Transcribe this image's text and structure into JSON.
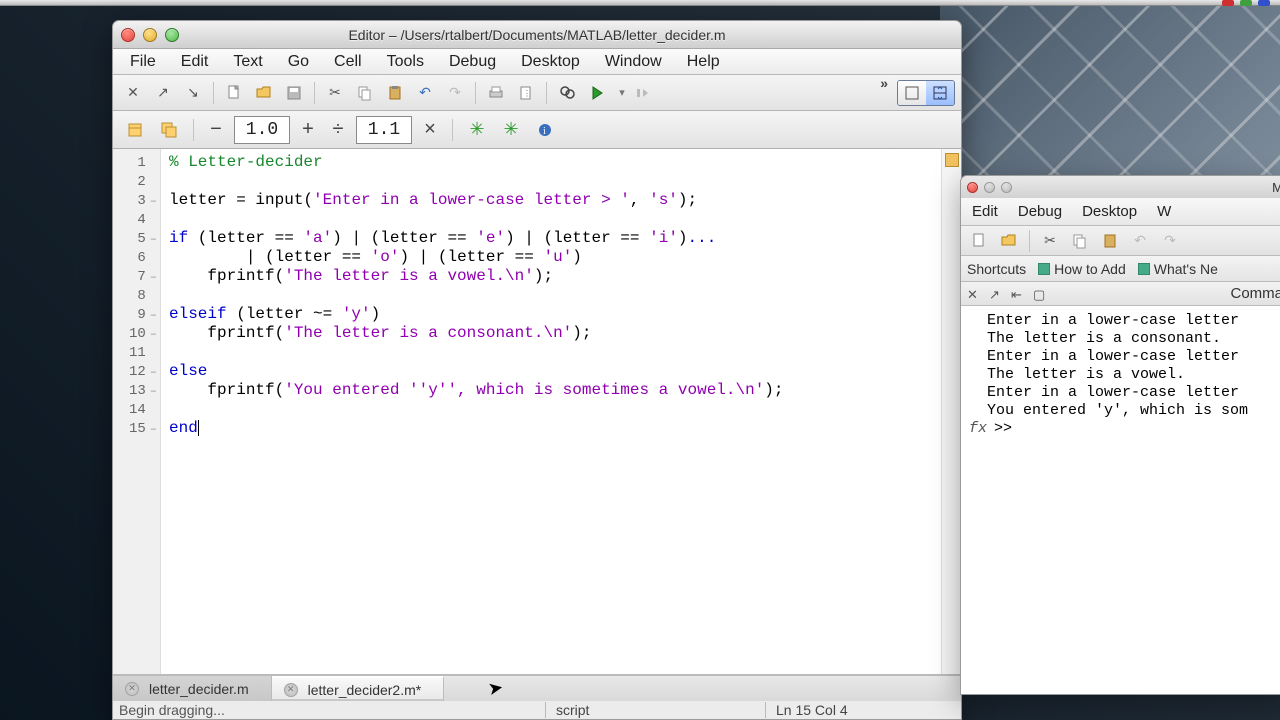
{
  "editor": {
    "title": "Editor – /Users/rtalbert/Documents/MATLAB/letter_decider.m",
    "menus": [
      "File",
      "Edit",
      "Text",
      "Go",
      "Cell",
      "Tools",
      "Debug",
      "Desktop",
      "Window",
      "Help"
    ],
    "cell_fields": {
      "left": "1.0",
      "right": "1.1"
    },
    "toolbar_icons": [
      "close-dock-icon",
      "undock-icon",
      "dock-arrow-icon",
      "new-file-icon",
      "open-folder-icon",
      "save-icon",
      "cut-icon",
      "copy-icon",
      "paste-icon",
      "undo-icon",
      "redo-icon",
      "print-icon",
      "insert-icon",
      "find-icon",
      "run-icon",
      "run-section-icon"
    ],
    "code_lines": [
      {
        "n": 1,
        "dash": false,
        "html": "<span class='cm'>% Letter-decider</span>"
      },
      {
        "n": 2,
        "dash": false,
        "html": ""
      },
      {
        "n": 3,
        "dash": true,
        "html": "letter = input(<span class='st'>'Enter in a lower-case letter &gt; '</span>, <span class='st'>'s'</span>);"
      },
      {
        "n": 4,
        "dash": false,
        "html": ""
      },
      {
        "n": 5,
        "dash": true,
        "html": "<span class='kw'>if</span> (letter == <span class='st'>'a'</span>) | (letter == <span class='st'>'e'</span>) | (letter == <span class='st'>'i'</span>)<span class='kw'>...</span>"
      },
      {
        "n": 6,
        "dash": false,
        "html": "        | (letter == <span class='st'>'o'</span>) | (letter == <span class='st'>'u'</span>)"
      },
      {
        "n": 7,
        "dash": true,
        "html": "    fprintf(<span class='st'>'The letter is a vowel.\\n'</span>);"
      },
      {
        "n": 8,
        "dash": false,
        "html": ""
      },
      {
        "n": 9,
        "dash": true,
        "html": "<span class='kw'>elseif</span> (letter ~= <span class='st'>'y'</span>)"
      },
      {
        "n": 10,
        "dash": true,
        "html": "    fprintf(<span class='st'>'The letter is a consonant.\\n'</span>);"
      },
      {
        "n": 11,
        "dash": false,
        "html": ""
      },
      {
        "n": 12,
        "dash": true,
        "html": "<span class='kw'>else</span>"
      },
      {
        "n": 13,
        "dash": true,
        "html": "    fprintf(<span class='st'>'You entered ''y'', which is sometimes a vowel.\\n'</span>);"
      },
      {
        "n": 14,
        "dash": false,
        "html": ""
      },
      {
        "n": 15,
        "dash": true,
        "html": "<span class='kw'>end</span><span class='cursor-bar'></span>"
      }
    ],
    "tabs": [
      {
        "label": "letter_decider.m",
        "active": false
      },
      {
        "label": "letter_decider2.m*",
        "active": true
      }
    ],
    "status": {
      "drag_msg": "Begin dragging...",
      "type": "script",
      "linecol": "Ln  15    Col  4"
    }
  },
  "cmd": {
    "title_end": "M",
    "menus": [
      "Edit",
      "Debug",
      "Desktop",
      "W"
    ],
    "shortcuts_label": "Shortcuts",
    "links": [
      "How to Add",
      "What's Ne"
    ],
    "heading": "Comma",
    "output_lines": [
      "Enter in a lower-case letter",
      "The letter is a consonant.",
      "Enter in a lower-case letter",
      "The letter is a vowel.",
      "Enter in a lower-case letter",
      "You entered 'y', which is som"
    ],
    "prompt": ">> "
  }
}
